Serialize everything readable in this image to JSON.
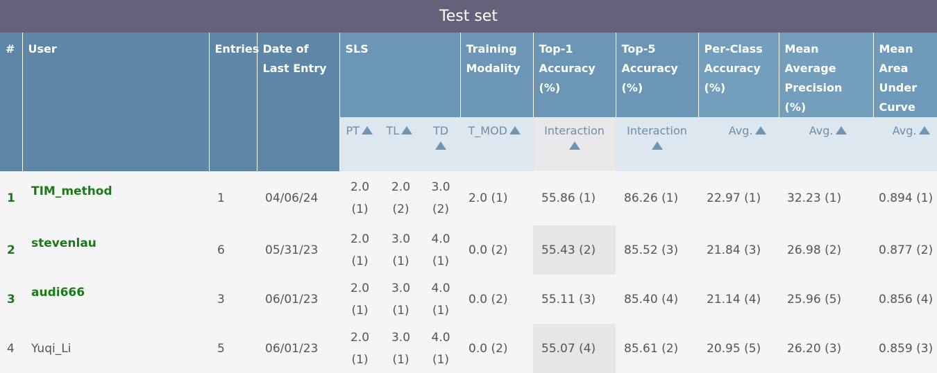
{
  "title": "Test set",
  "headers": {
    "rank": "#",
    "user": "User",
    "entries": "Entries",
    "date": "Date of Last Entry",
    "sls": "SLS",
    "training": "Training Modality",
    "top1": "Top-1 Accuracy (%)",
    "top5": "Top-5 Accuracy (%)",
    "perclass": "Per-Class Accuracy (%)",
    "map": "Mean Average Precision (%)",
    "auc": "Mean Area Under Curve"
  },
  "subheaders": {
    "pt": "PT",
    "tl": "TL",
    "td": "TD",
    "t_mod": "T_MOD",
    "top1": "Interaction",
    "top5": "Interaction",
    "perclass": "Avg.",
    "map": "Avg.",
    "auc": "Avg."
  },
  "rows": [
    {
      "rank": "1",
      "user": "TIM_method",
      "entries": "1",
      "date": "04/06/24",
      "pt": "2.0",
      "pt_r": "(1)",
      "tl": "2.0",
      "tl_r": "(2)",
      "td": "3.0",
      "td_r": "(2)",
      "tmod": "2.0 (1)",
      "top1": "55.86 (1)",
      "top5": "86.26 (1)",
      "perclass": "22.97 (1)",
      "map": "32.23 (1)",
      "auc": "0.894 (1)"
    },
    {
      "rank": "2",
      "user": "stevenlau",
      "entries": "6",
      "date": "05/31/23",
      "pt": "2.0",
      "pt_r": "(1)",
      "tl": "3.0",
      "tl_r": "(1)",
      "td": "4.0",
      "td_r": "(1)",
      "tmod": "0.0 (2)",
      "top1": "55.43 (2)",
      "top5": "85.52 (3)",
      "perclass": "21.84 (3)",
      "map": "26.98 (2)",
      "auc": "0.877 (2)"
    },
    {
      "rank": "3",
      "user": "audi666",
      "entries": "3",
      "date": "06/01/23",
      "pt": "2.0",
      "pt_r": "(1)",
      "tl": "3.0",
      "tl_r": "(1)",
      "td": "4.0",
      "td_r": "(1)",
      "tmod": "0.0 (2)",
      "top1": "55.11 (3)",
      "top5": "85.40 (4)",
      "perclass": "21.14 (4)",
      "map": "25.96 (5)",
      "auc": "0.856 (4)"
    },
    {
      "rank": "4",
      "user": "Yuqi_Li",
      "entries": "5",
      "date": "06/01/23",
      "pt": "2.0",
      "pt_r": "(1)",
      "tl": "3.0",
      "tl_r": "(1)",
      "td": "4.0",
      "td_r": "(1)",
      "tmod": "0.0 (2)",
      "top1": "55.07 (4)",
      "top5": "85.61 (2)",
      "perclass": "20.95 (5)",
      "map": "26.20 (3)",
      "auc": "0.859 (3)"
    }
  ],
  "colors": {
    "title_bg": "#67607a",
    "header_bg": "#6b96b5",
    "subheader_bg": "#dce7f0",
    "winner_text": "#1a7a1a"
  }
}
